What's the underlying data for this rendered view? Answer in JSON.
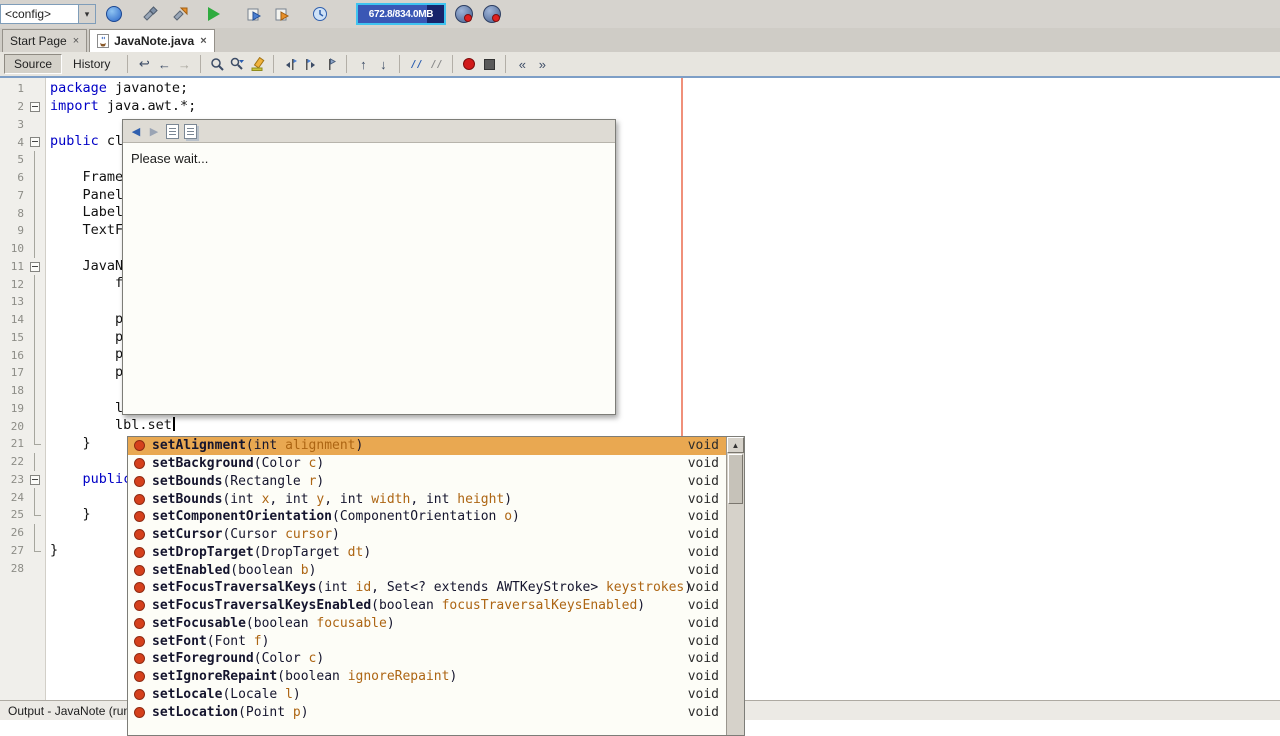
{
  "glyphs": {
    "close": "×",
    "dropdown": "▾",
    "scroll_up": "▲",
    "back": "◀",
    "forward": "▶",
    "prev": "←",
    "next": "→",
    "last_edit": "↩",
    "up": "↑",
    "down": "↓",
    "shift_left": "«",
    "shift_right": "»",
    "comment": "//"
  },
  "toolbar": {
    "config_value": "<config>",
    "icons": [
      "globe-icon",
      "build-project-icon",
      "clean-build-icon",
      "run-project-icon",
      "debug-project-icon",
      "profile-project-icon",
      "clock-icon"
    ],
    "memory_text": "672.8/834.0MB",
    "right_icons": [
      "record-badge-icon-1",
      "record-badge-icon-2"
    ]
  },
  "tabs": [
    {
      "label": "Start Page",
      "active": false
    },
    {
      "label": "JavaNote.java",
      "active": true
    }
  ],
  "editor_toolbar": {
    "source_label": "Source",
    "history_label": "History",
    "icons": [
      "last-edit-icon",
      "back-icon",
      "forward-icon",
      "find-selection-icon",
      "find-next-icon",
      "highlight-icon",
      "prev-bookmark-icon",
      "next-bookmark-icon",
      "toggle-bookmark-icon",
      "prev-occurrence-icon",
      "next-occurrence-icon",
      "comment-icon",
      "uncomment-icon",
      "record-macro-icon",
      "stop-macro-icon",
      "shift-left-icon",
      "shift-right-icon"
    ]
  },
  "editor": {
    "keyword_color": "#0000c6",
    "margin_line_color": "#f0907a",
    "lines": [
      {
        "n": 1,
        "segs": [
          [
            "k",
            "package"
          ],
          [
            "p",
            " javanote;"
          ]
        ]
      },
      {
        "n": 2,
        "fold": "box",
        "segs": [
          [
            "k",
            "import"
          ],
          [
            "p",
            " java.awt.*;"
          ]
        ]
      },
      {
        "n": 3,
        "segs": []
      },
      {
        "n": 4,
        "fold": "box",
        "segs": [
          [
            "k",
            "public"
          ],
          [
            "p",
            " cl"
          ]
        ]
      },
      {
        "n": 5,
        "fold": "line",
        "segs": []
      },
      {
        "n": 6,
        "fold": "line",
        "segs": [
          [
            "p",
            "    Frame"
          ]
        ]
      },
      {
        "n": 7,
        "fold": "line",
        "segs": [
          [
            "p",
            "    Panel"
          ]
        ]
      },
      {
        "n": 8,
        "fold": "line",
        "segs": [
          [
            "p",
            "    Label"
          ]
        ]
      },
      {
        "n": 9,
        "fold": "line",
        "segs": [
          [
            "p",
            "    TextF"
          ]
        ]
      },
      {
        "n": 10,
        "fold": "line",
        "segs": []
      },
      {
        "n": 11,
        "fold": "box",
        "segs": [
          [
            "p",
            "    JavaN"
          ]
        ]
      },
      {
        "n": 12,
        "fold": "line",
        "segs": [
          [
            "p",
            "        f"
          ]
        ]
      },
      {
        "n": 13,
        "fold": "line",
        "segs": []
      },
      {
        "n": 14,
        "fold": "line",
        "segs": [
          [
            "p",
            "        p"
          ]
        ]
      },
      {
        "n": 15,
        "fold": "line",
        "segs": [
          [
            "p",
            "        p"
          ]
        ]
      },
      {
        "n": 16,
        "fold": "line",
        "segs": [
          [
            "p",
            "        p"
          ]
        ]
      },
      {
        "n": 17,
        "fold": "line",
        "segs": [
          [
            "p",
            "        p"
          ]
        ]
      },
      {
        "n": 18,
        "fold": "line",
        "segs": []
      },
      {
        "n": 19,
        "fold": "line",
        "segs": [
          [
            "p",
            "        l"
          ]
        ]
      },
      {
        "n": 20,
        "fold": "line",
        "caret": true,
        "segs": [
          [
            "p",
            "        lbl.set"
          ]
        ]
      },
      {
        "n": 21,
        "fold": "end",
        "segs": [
          [
            "p",
            "    }"
          ]
        ]
      },
      {
        "n": 22,
        "fold": "line",
        "segs": []
      },
      {
        "n": 23,
        "fold": "box",
        "segs": [
          [
            "p",
            "    "
          ],
          [
            "k",
            "public"
          ],
          [
            "p",
            " c"
          ]
        ]
      },
      {
        "n": 24,
        "fold": "line",
        "segs": []
      },
      {
        "n": 25,
        "fold": "end",
        "segs": [
          [
            "p",
            "    }"
          ]
        ]
      },
      {
        "n": 26,
        "fold": "line",
        "segs": []
      },
      {
        "n": 27,
        "fold": "end",
        "segs": [
          [
            "p",
            "}"
          ]
        ]
      },
      {
        "n": 28,
        "segs": []
      }
    ]
  },
  "wait_popup": {
    "message": "Please wait...",
    "icons": [
      "back-icon",
      "forward-icon",
      "show-in-browser-icon",
      "copy-icon"
    ]
  },
  "completion": {
    "selected_bg": "#e9a851",
    "items": [
      {
        "name": "setAlignment",
        "params": [
          [
            "int ",
            "alignment"
          ]
        ],
        "ret": "void",
        "selected": true
      },
      {
        "name": "setBackground",
        "params": [
          [
            "Color ",
            "c"
          ]
        ],
        "ret": "void"
      },
      {
        "name": "setBounds",
        "params": [
          [
            "Rectangle ",
            "r"
          ]
        ],
        "ret": "void"
      },
      {
        "name": "setBounds",
        "params": [
          [
            "int ",
            "x"
          ],
          [
            "int ",
            "y"
          ],
          [
            "int ",
            "width"
          ],
          [
            "int ",
            "height"
          ]
        ],
        "ret": "void"
      },
      {
        "name": "setComponentOrientation",
        "params": [
          [
            "ComponentOrientation ",
            "o"
          ]
        ],
        "ret": "void"
      },
      {
        "name": "setCursor",
        "params": [
          [
            "Cursor ",
            "cursor"
          ]
        ],
        "ret": "void"
      },
      {
        "name": "setDropTarget",
        "params": [
          [
            "DropTarget ",
            "dt"
          ]
        ],
        "ret": "void"
      },
      {
        "name": "setEnabled",
        "params": [
          [
            "boolean ",
            "b"
          ]
        ],
        "ret": "void"
      },
      {
        "name": "setFocusTraversalKeys",
        "params": [
          [
            "int ",
            "id"
          ],
          [
            "Set<? extends AWTKeyStroke> ",
            "keystrokes"
          ]
        ],
        "ret": "void"
      },
      {
        "name": "setFocusTraversalKeysEnabled",
        "params": [
          [
            "boolean ",
            "focusTraversalKeysEnabled"
          ]
        ],
        "ret": "void"
      },
      {
        "name": "setFocusable",
        "params": [
          [
            "boolean ",
            "focusable"
          ]
        ],
        "ret": "void"
      },
      {
        "name": "setFont",
        "params": [
          [
            "Font ",
            "f"
          ]
        ],
        "ret": "void"
      },
      {
        "name": "setForeground",
        "params": [
          [
            "Color ",
            "c"
          ]
        ],
        "ret": "void"
      },
      {
        "name": "setIgnoreRepaint",
        "params": [
          [
            "boolean ",
            "ignoreRepaint"
          ]
        ],
        "ret": "void"
      },
      {
        "name": "setLocale",
        "params": [
          [
            "Locale ",
            "l"
          ]
        ],
        "ret": "void"
      },
      {
        "name": "setLocation",
        "params": [
          [
            "Point ",
            "p"
          ]
        ],
        "ret": "void"
      }
    ]
  },
  "statusbar": {
    "text": "Output - JavaNote (run"
  }
}
